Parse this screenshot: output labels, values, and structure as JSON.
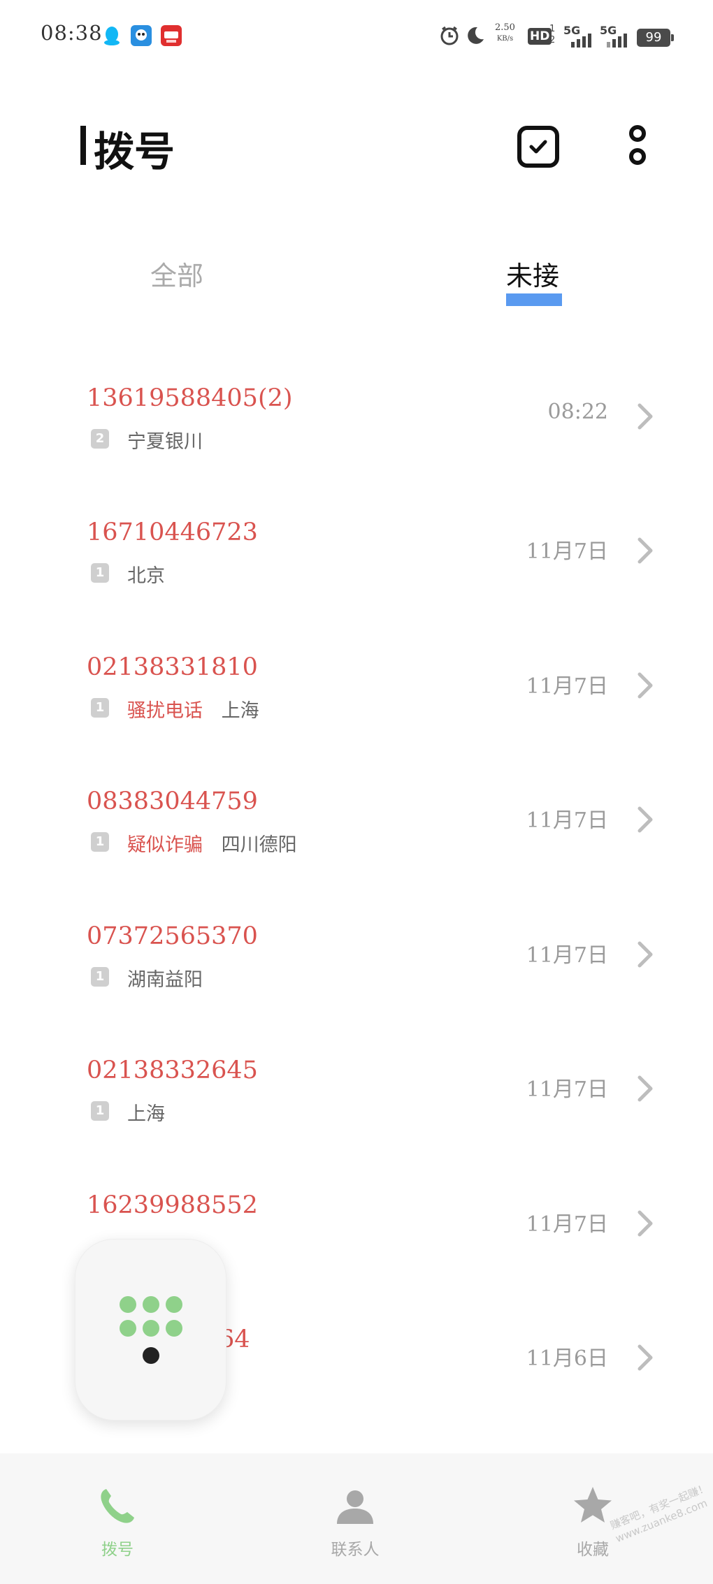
{
  "status_bar": {
    "time": "08:38",
    "net_speed_value": "2.50",
    "net_speed_unit": "KB/s",
    "hd_label": "HD",
    "signal1_label": "5G",
    "signal2_label": "5G",
    "battery": "99"
  },
  "header": {
    "title": "拨号"
  },
  "tabs": [
    {
      "label": "全部",
      "active": false
    },
    {
      "label": "未接",
      "active": true
    }
  ],
  "calls": [
    {
      "number": "13619588405(2)",
      "sim": "2",
      "tag": "",
      "location": "宁夏银川",
      "time": "08:22"
    },
    {
      "number": "16710446723",
      "sim": "1",
      "tag": "",
      "location": "北京",
      "time": "11月7日"
    },
    {
      "number": "02138331810",
      "sim": "1",
      "tag": "骚扰电话",
      "location": "上海",
      "time": "11月7日"
    },
    {
      "number": "08383044759",
      "sim": "1",
      "tag": "疑似诈骗",
      "location": "四川德阳",
      "time": "11月7日"
    },
    {
      "number": "07372565370",
      "sim": "1",
      "tag": "",
      "location": "湖南益阳",
      "time": "11月7日"
    },
    {
      "number": "02138332645",
      "sim": "1",
      "tag": "",
      "location": "上海",
      "time": "11月7日"
    },
    {
      "number": "16239988552",
      "sim": "",
      "tag": "",
      "location": "",
      "time": "11月7日"
    },
    {
      "number": "64",
      "sim": "",
      "tag": "",
      "location": "",
      "time": "11月6日"
    }
  ],
  "bottom_nav": {
    "items": [
      {
        "label": "拨号",
        "icon": "phone-icon",
        "active": true
      },
      {
        "label": "联系人",
        "icon": "person-icon",
        "active": false
      },
      {
        "label": "收藏",
        "icon": "star-icon",
        "active": false
      }
    ]
  },
  "watermark": {
    "line1": "赚客吧，有奖一起赚！",
    "line2": "www.zuanke8.com"
  },
  "colors": {
    "missed_number": "#d9534f",
    "tab_indicator": "#5a9af0",
    "nav_active": "#8fd18a",
    "nav_inactive": "#a8a8a8"
  }
}
